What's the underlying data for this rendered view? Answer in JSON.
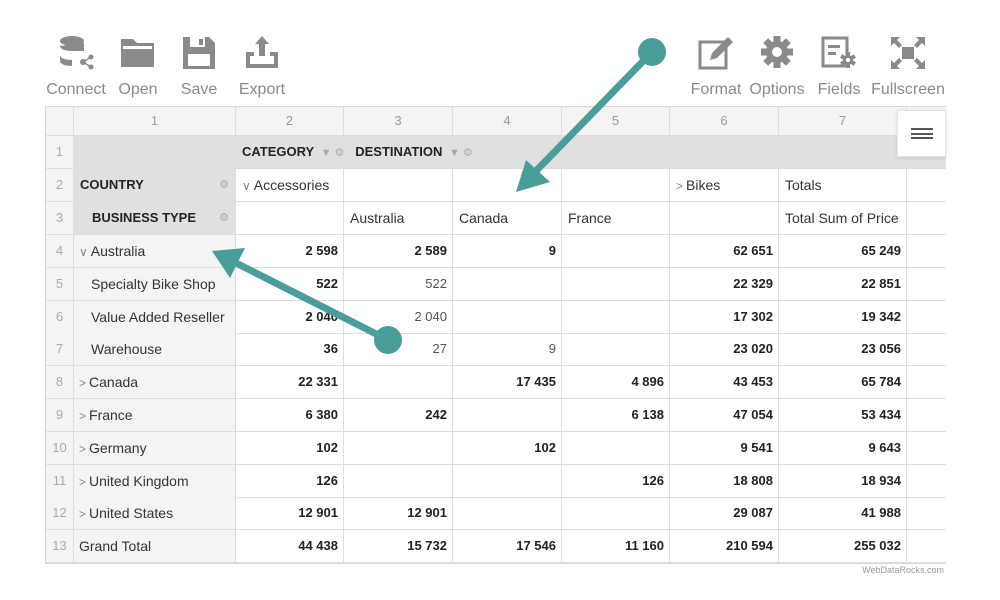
{
  "toolbar": {
    "connect": "Connect",
    "open": "Open",
    "save": "Save",
    "export": "Export",
    "format": "Format",
    "options": "Options",
    "fields": "Fields",
    "fullscreen": "Fullscreen"
  },
  "colors": {
    "icon": "#8a8a8a",
    "arrow": "#4a9e9a",
    "header_bg": "#e0e0e0",
    "row_header_bg": "#f4f4f4"
  },
  "columns": [
    "1",
    "2",
    "3",
    "4",
    "5",
    "6",
    "7"
  ],
  "row_numbers": [
    "1",
    "2",
    "3",
    "4",
    "5",
    "6",
    "7",
    "8",
    "9",
    "10",
    "11",
    "12",
    "13"
  ],
  "headers": {
    "category": "CATEGORY",
    "destination": "DESTINATION",
    "country": "COUNTRY",
    "business_type": "BUSINESS TYPE",
    "accessories": "Accessories",
    "bikes": "Bikes",
    "totals": "Totals",
    "australia": "Australia",
    "canada": "Canada",
    "france": "France",
    "total_sum": "Total Sum of Price"
  },
  "rows": [
    {
      "label": "Australia",
      "expand": "v",
      "indent": 0,
      "values": [
        "2 598",
        "2 589",
        "9",
        "",
        "62 651",
        "65 249"
      ],
      "bold": true
    },
    {
      "label": "Specialty Bike Shop",
      "expand": "",
      "indent": 1,
      "values": [
        "522",
        "522",
        "",
        "",
        "22 329",
        "22 851"
      ],
      "bold": false
    },
    {
      "label": "Value Added Reseller",
      "expand": "",
      "indent": 1,
      "values": [
        "2 040",
        "2 040",
        "",
        "",
        "17 302",
        "19 342"
      ],
      "bold": false
    },
    {
      "label": "Warehouse",
      "expand": "",
      "indent": 1,
      "values": [
        "36",
        "27",
        "9",
        "",
        "23 020",
        "23 056"
      ],
      "bold": false
    },
    {
      "label": "Canada",
      "expand": ">",
      "indent": 0,
      "values": [
        "22 331",
        "",
        "17 435",
        "4 896",
        "43 453",
        "65 784"
      ],
      "bold": true
    },
    {
      "label": "France",
      "expand": ">",
      "indent": 0,
      "values": [
        "6 380",
        "242",
        "",
        "6 138",
        "47 054",
        "53 434"
      ],
      "bold": true
    },
    {
      "label": "Germany",
      "expand": ">",
      "indent": 0,
      "values": [
        "102",
        "",
        "102",
        "",
        "9 541",
        "9 643"
      ],
      "bold": true
    },
    {
      "label": "United Kingdom",
      "expand": ">",
      "indent": 0,
      "values": [
        "126",
        "",
        "",
        "126",
        "18 808",
        "18 934"
      ],
      "bold": true
    },
    {
      "label": "United States",
      "expand": ">",
      "indent": 0,
      "values": [
        "12 901",
        "12 901",
        "",
        "",
        "29 087",
        "41 988"
      ],
      "bold": true
    },
    {
      "label": "Grand Total",
      "expand": "",
      "indent": 0,
      "values": [
        "44 438",
        "15 732",
        "17 546",
        "11 160",
        "210 594",
        "255 032"
      ],
      "bold": true
    }
  ],
  "watermark": "WebDataRocks.com"
}
